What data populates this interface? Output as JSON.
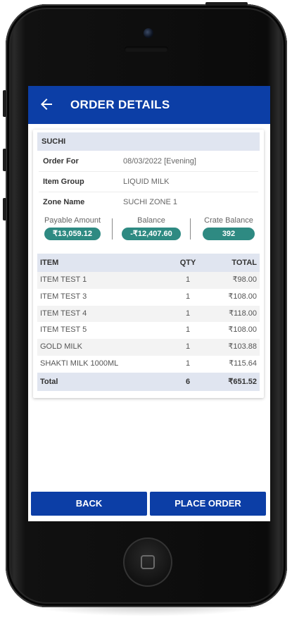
{
  "header": {
    "title": "ORDER DETAILS",
    "back_icon": "arrow-left-icon"
  },
  "customer": {
    "name": "SUCHI"
  },
  "details": [
    {
      "label": "Order For",
      "value": "08/03/2022 [Evening]"
    },
    {
      "label": "Item Group",
      "value": "LIQUID MILK"
    },
    {
      "label": "Zone Name",
      "value": "SUCHI ZONE 1"
    }
  ],
  "summary": [
    {
      "label": "Payable Amount",
      "value": "₹13,059.12"
    },
    {
      "label": "Balance",
      "value": "-₹12,407.60"
    },
    {
      "label": "Crate Balance",
      "value": "392"
    }
  ],
  "table": {
    "headers": {
      "item": "ITEM",
      "qty": "QTY",
      "total": "TOTAL"
    },
    "rows": [
      {
        "item": "ITEM TEST 1",
        "qty": "1",
        "total": "₹98.00"
      },
      {
        "item": "ITEM TEST 3",
        "qty": "1",
        "total": "₹108.00"
      },
      {
        "item": "ITEM TEST 4",
        "qty": "1",
        "total": "₹118.00"
      },
      {
        "item": "ITEM TEST 5",
        "qty": "1",
        "total": "₹108.00"
      },
      {
        "item": "GOLD MILK",
        "qty": "1",
        "total": "₹103.88"
      },
      {
        "item": "SHAKTI MILK 1000ML",
        "qty": "1",
        "total": "₹115.64"
      }
    ],
    "footer": {
      "label": "Total",
      "qty": "6",
      "total": "₹651.52"
    }
  },
  "actions": {
    "back_label": "BACK",
    "place_order_label": "PLACE ORDER"
  },
  "colors": {
    "primary": "#0c3ea6",
    "pill": "#2e8a82",
    "header_bg": "#e0e5f0"
  }
}
